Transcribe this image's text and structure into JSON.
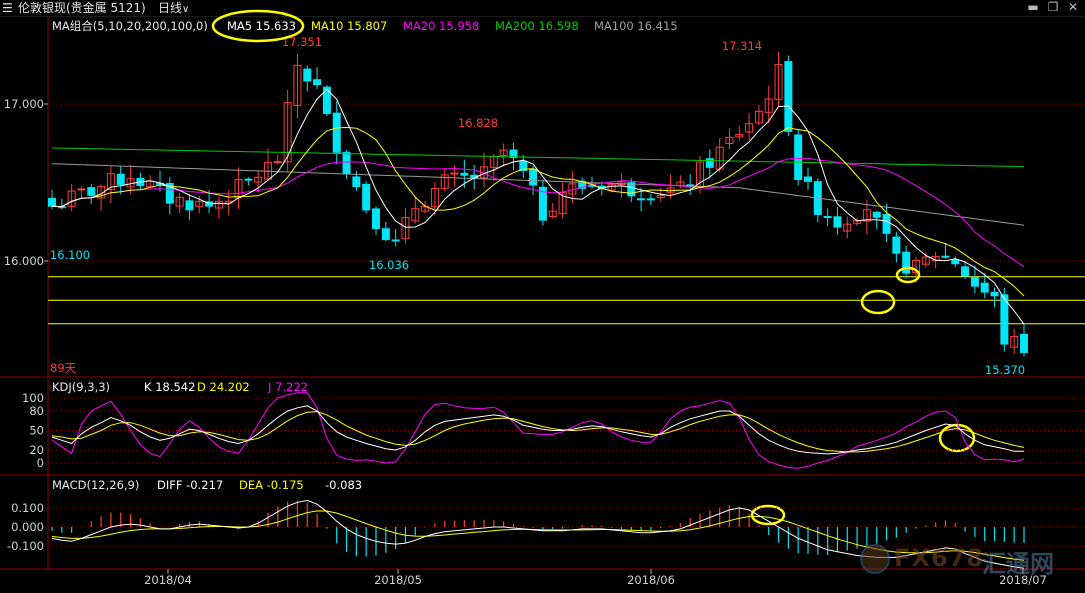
{
  "header": {
    "instrument": "伦敦银现(贵金属 5121)",
    "period": "日线",
    "period_chevron": "∨"
  },
  "colors": {
    "up": "#ff3b3b",
    "down": "#00e5f5",
    "ma5": "#ffffff",
    "ma10": "#ffff00",
    "ma20": "#ff00ff",
    "ma200": "#00cc00",
    "ma100": "#9a9a9a",
    "k": "#ffffff",
    "d": "#ffff00",
    "j": "#ff00ff",
    "highlight": "#ffff00",
    "grid": "#8b0000"
  },
  "main_legend": {
    "group": "MA组合(5,10,20,200,100,0)",
    "ma5": "MA5 15.633",
    "ma10": "MA10 15.807",
    "ma20": "MA20 15.958",
    "ma200": "MA200 16.598",
    "ma100": "MA100 16.415"
  },
  "kdj_legend": {
    "group": "KDJ(9,3,3)",
    "k": "K 18.542",
    "d": "D 24.202",
    "j": "J 7.222"
  },
  "macd_legend": {
    "group": "MACD(12,26,9)",
    "diff": "DIFF -0.217",
    "dea": "DEA -0.175",
    "macd": "-0.083"
  },
  "annotations": {
    "high1": "17.351",
    "high2": "16.828",
    "high3": "17.314",
    "low1": "16.100",
    "low2": "16.036",
    "low3": "15.370",
    "days": "89天"
  },
  "watermark": {
    "text": "FX678",
    "cn": "汇通网"
  },
  "chart_data": {
    "type": "candlestick",
    "instrument": "伦敦银现",
    "period": "日线",
    "y_ticks": [
      "17.000",
      "16.000"
    ],
    "x_ticks": [
      "2018/04",
      "2018/05",
      "2018/06",
      "2018/07"
    ],
    "ylim": [
      15.3,
      17.6
    ],
    "horizontal_lines": [
      15.9,
      15.75,
      15.6
    ],
    "kdj": {
      "y_ticks": [
        "100",
        "80",
        "50",
        "20",
        "0"
      ],
      "ylim": [
        -10,
        110
      ],
      "K": [
        40,
        35,
        30,
        45,
        55,
        62,
        70,
        65,
        58,
        48,
        40,
        35,
        38,
        45,
        52,
        50,
        44,
        38,
        33,
        30,
        35,
        45,
        58,
        70,
        80,
        85,
        88,
        80,
        62,
        48,
        40,
        35,
        30,
        26,
        22,
        20,
        25,
        35,
        48,
        58,
        64,
        66,
        68,
        70,
        72,
        74,
        72,
        66,
        58,
        55,
        52,
        50,
        50,
        52,
        55,
        57,
        56,
        52,
        48,
        45,
        42,
        40,
        45,
        55,
        62,
        68,
        72,
        76,
        80,
        80,
        72,
        58,
        45,
        35,
        28,
        22,
        18,
        16,
        15,
        14,
        15,
        17,
        20,
        22,
        25,
        28,
        32,
        38,
        44,
        50,
        55,
        60,
        58,
        45,
        35,
        28,
        25,
        22,
        18,
        18
      ],
      "D": [
        42,
        40,
        37,
        38,
        44,
        50,
        58,
        62,
        62,
        58,
        52,
        46,
        42,
        42,
        46,
        48,
        47,
        44,
        40,
        36,
        35,
        38,
        45,
        55,
        65,
        73,
        78,
        79,
        74,
        66,
        57,
        50,
        43,
        38,
        33,
        29,
        27,
        29,
        35,
        42,
        50,
        56,
        60,
        63,
        66,
        68,
        69,
        68,
        64,
        60,
        56,
        53,
        51,
        50,
        51,
        53,
        54,
        54,
        52,
        50,
        47,
        44,
        44,
        48,
        53,
        59,
        64,
        68,
        72,
        74,
        74,
        69,
        61,
        52,
        44,
        37,
        31,
        26,
        22,
        19,
        18,
        17,
        17,
        18,
        20,
        22,
        25,
        29,
        34,
        39,
        44,
        50,
        53,
        51,
        46,
        40,
        35,
        31,
        27,
        24
      ],
      "J": [
        35,
        25,
        15,
        60,
        80,
        88,
        95,
        75,
        50,
        28,
        15,
        10,
        30,
        52,
        65,
        55,
        38,
        25,
        18,
        15,
        35,
        60,
        85,
        100,
        105,
        108,
        108,
        85,
        38,
        12,
        6,
        4,
        5,
        3,
        0,
        2,
        22,
        48,
        75,
        90,
        92,
        88,
        85,
        84,
        84,
        86,
        78,
        62,
        46,
        45,
        44,
        44,
        48,
        55,
        62,
        65,
        60,
        48,
        40,
        35,
        32,
        32,
        47,
        68,
        80,
        86,
        88,
        92,
        96,
        92,
        70,
        36,
        13,
        2,
        -3,
        -7,
        -8,
        -5,
        0,
        4,
        10,
        16,
        26,
        30,
        35,
        40,
        46,
        56,
        63,
        72,
        78,
        80,
        70,
        32,
        13,
        5,
        6,
        5,
        2,
        6
      ]
    },
    "macd": {
      "y_ticks": [
        "0.100",
        "0.000",
        "-0.100"
      ],
      "ylim": [
        -0.17,
        0.17
      ],
      "DIFF": [
        -0.06,
        -0.07,
        -0.075,
        -0.06,
        -0.04,
        -0.02,
        0.0,
        0.01,
        0.015,
        0.01,
        0.0,
        -0.01,
        -0.01,
        0.0,
        0.01,
        0.015,
        0.01,
        0.005,
        0.0,
        -0.005,
        0.0,
        0.02,
        0.05,
        0.08,
        0.11,
        0.13,
        0.14,
        0.12,
        0.08,
        0.03,
        -0.01,
        -0.04,
        -0.06,
        -0.075,
        -0.085,
        -0.09,
        -0.085,
        -0.07,
        -0.05,
        -0.035,
        -0.025,
        -0.02,
        -0.015,
        -0.01,
        -0.005,
        0.0,
        0.0,
        -0.005,
        -0.01,
        -0.015,
        -0.02,
        -0.02,
        -0.02,
        -0.015,
        -0.01,
        -0.01,
        -0.01,
        -0.015,
        -0.02,
        -0.025,
        -0.03,
        -0.03,
        -0.025,
        -0.02,
        -0.01,
        0.01,
        0.03,
        0.05,
        0.07,
        0.09,
        0.1,
        0.09,
        0.06,
        0.03,
        0.0,
        -0.03,
        -0.06,
        -0.08,
        -0.1,
        -0.12,
        -0.13,
        -0.14,
        -0.15,
        -0.155,
        -0.16,
        -0.16,
        -0.16,
        -0.15,
        -0.14,
        -0.13,
        -0.12,
        -0.11,
        -0.115,
        -0.14,
        -0.16,
        -0.18,
        -0.19,
        -0.2,
        -0.21,
        -0.217
      ],
      "DEA": [
        -0.05,
        -0.055,
        -0.06,
        -0.06,
        -0.055,
        -0.048,
        -0.038,
        -0.028,
        -0.019,
        -0.013,
        -0.01,
        -0.01,
        -0.01,
        -0.008,
        -0.004,
        0.0,
        0.002,
        0.003,
        0.002,
        0.0,
        0.0,
        0.004,
        0.013,
        0.026,
        0.043,
        0.06,
        0.076,
        0.085,
        0.084,
        0.073,
        0.056,
        0.037,
        0.018,
        0.0,
        -0.017,
        -0.032,
        -0.043,
        -0.048,
        -0.049,
        -0.046,
        -0.042,
        -0.037,
        -0.033,
        -0.028,
        -0.024,
        -0.019,
        -0.015,
        -0.013,
        -0.012,
        -0.013,
        -0.014,
        -0.015,
        -0.016,
        -0.016,
        -0.015,
        -0.014,
        -0.013,
        -0.013,
        -0.015,
        -0.017,
        -0.019,
        -0.021,
        -0.022,
        -0.022,
        -0.02,
        -0.014,
        -0.005,
        0.006,
        0.019,
        0.033,
        0.046,
        0.055,
        0.056,
        0.051,
        0.041,
        0.027,
        0.009,
        -0.009,
        -0.027,
        -0.046,
        -0.063,
        -0.078,
        -0.093,
        -0.105,
        -0.116,
        -0.125,
        -0.132,
        -0.135,
        -0.136,
        -0.135,
        -0.132,
        -0.128,
        -0.125,
        -0.128,
        -0.134,
        -0.143,
        -0.152,
        -0.161,
        -0.169,
        -0.175
      ]
    }
  }
}
